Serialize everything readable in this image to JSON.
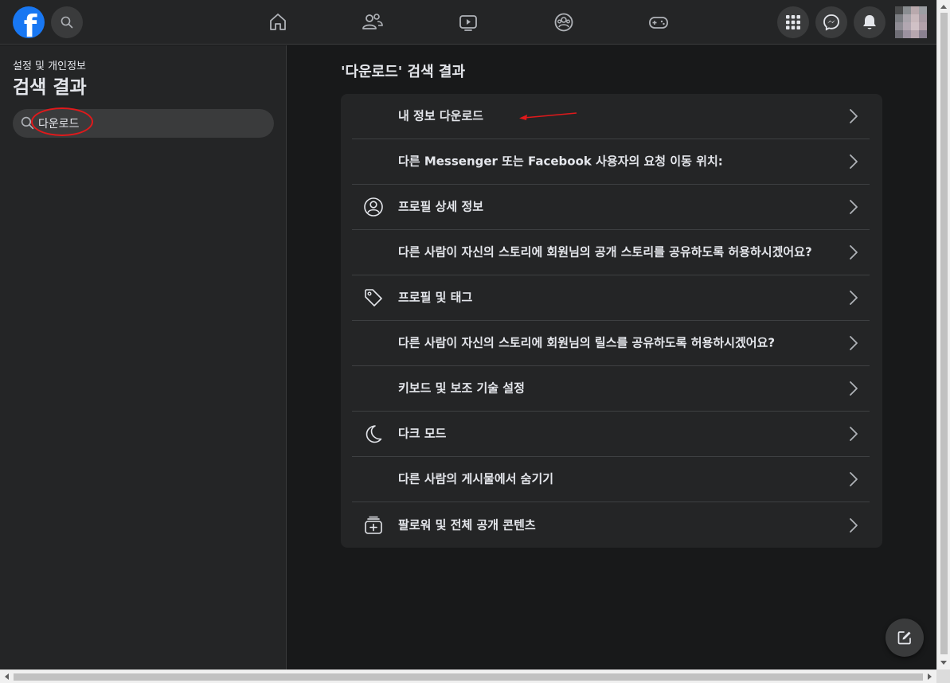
{
  "topbar": {
    "logo_letter": "f",
    "icons": [
      "facebook-logo",
      "search-icon",
      "home-icon",
      "friends-icon",
      "watch-icon",
      "groups-icon",
      "gaming-icon",
      "menu-grid-icon",
      "messenger-icon",
      "bell-icon"
    ]
  },
  "sidebar": {
    "breadcrumb": "설정 및 개인정보",
    "title": "검색 결과",
    "search": {
      "value": "다운로드"
    }
  },
  "main": {
    "title": "'다운로드' 검색 결과",
    "results": [
      {
        "label": "내 정보 다운로드",
        "icon": ""
      },
      {
        "label": "다른 Messenger 또는 Facebook 사용자의 요청 이동 위치:",
        "icon": ""
      },
      {
        "label": "프로필 상세 정보",
        "icon": "user-circle-icon"
      },
      {
        "label": "다른 사람이 자신의 스토리에 회원님의 공개 스토리를 공유하도록 허용하시겠어요?",
        "icon": ""
      },
      {
        "label": "프로필 및 태그",
        "icon": "tag-icon"
      },
      {
        "label": "다른 사람이 자신의 스토리에 회원님의 릴스를 공유하도록 허용하시겠어요?",
        "icon": ""
      },
      {
        "label": "키보드 및 보조 기술 설정",
        "icon": ""
      },
      {
        "label": "다크 모드",
        "icon": "moon-icon"
      },
      {
        "label": "다른 사람의 게시물에서 숨기기",
        "icon": ""
      },
      {
        "label": "팔로워 및 전체 공개 콘텐츠",
        "icon": "add-content-icon"
      }
    ]
  },
  "colors": {
    "background": "#18191a",
    "surface": "#242526",
    "brand": "#1877f2",
    "annotation": "#e0191b"
  }
}
